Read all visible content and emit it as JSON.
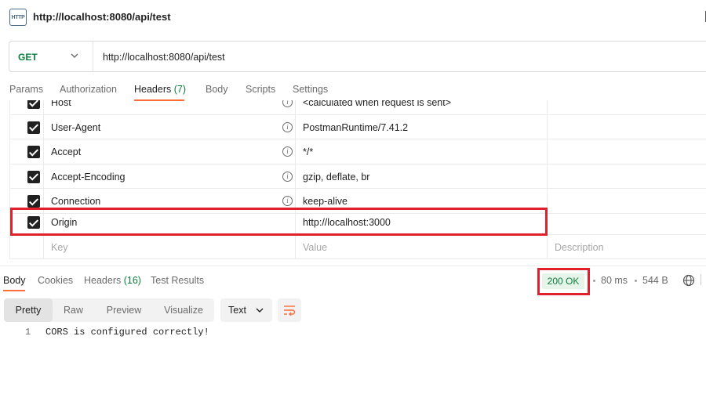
{
  "titlebar": {
    "icon_text": "HTTP",
    "title": "http://localhost:8080/api/test"
  },
  "request": {
    "method": "GET",
    "url": "http://localhost:8080/api/test"
  },
  "request_tabs": [
    {
      "label": "Params"
    },
    {
      "label": "Authorization"
    },
    {
      "label": "Headers",
      "count": "(7)"
    },
    {
      "label": "Body"
    },
    {
      "label": "Scripts"
    },
    {
      "label": "Settings"
    }
  ],
  "headers": {
    "rows": [
      {
        "key": "Host",
        "value": "<calculated when request is sent>",
        "checked": true
      },
      {
        "key": "User-Agent",
        "value": "PostmanRuntime/7.41.2",
        "checked": true
      },
      {
        "key": "Accept",
        "value": "*/*",
        "checked": true
      },
      {
        "key": "Accept-Encoding",
        "value": "gzip, deflate, br",
        "checked": true
      },
      {
        "key": "Connection",
        "value": "keep-alive",
        "checked": true
      },
      {
        "key": "Origin",
        "value": "http://localhost:3000",
        "checked": true
      }
    ],
    "placeholder": {
      "key": "Key",
      "value": "Value",
      "description": "Description"
    }
  },
  "response_tabs": [
    {
      "label": "Body"
    },
    {
      "label": "Cookies"
    },
    {
      "label": "Headers",
      "count": "(16)"
    },
    {
      "label": "Test Results"
    }
  ],
  "response_meta": {
    "status": "200 OK",
    "time": "80 ms",
    "size": "544 B"
  },
  "format": {
    "modes": [
      "Pretty",
      "Raw",
      "Preview",
      "Visualize"
    ],
    "selected_mode": "Pretty",
    "type": "Text"
  },
  "body": {
    "lines": [
      {
        "num": "1",
        "text": "CORS is configured correctly!"
      }
    ]
  },
  "colors": {
    "accent": "#ff6c37",
    "method_green": "#0a7d3b",
    "highlight_red": "#e0202a",
    "status_bg": "#e6f4ea"
  }
}
